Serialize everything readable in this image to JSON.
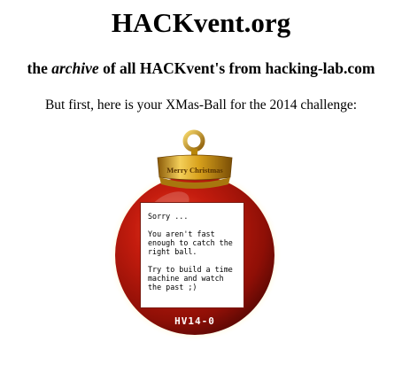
{
  "header": {
    "title": "HACKvent.org",
    "subtitle_prefix": "the ",
    "subtitle_emphasis": "archive",
    "subtitle_suffix": " of all HACKvent's from hacking-lab.com"
  },
  "intro": {
    "text": "But first, here is your XMas-Ball for the 2014 challenge:"
  },
  "ornament": {
    "cap_label": "Merry Christmas",
    "message_lines": [
      "Sorry ...",
      "You aren't fast enough to catch the right ball.",
      "Try to build a time machine and watch the past ;)"
    ],
    "code": "HV14-0",
    "colors": {
      "ball": "#b8180c",
      "ball_dark": "#5a0804",
      "cap": "#d9a21c",
      "cap_dark": "#8a5a08"
    }
  }
}
